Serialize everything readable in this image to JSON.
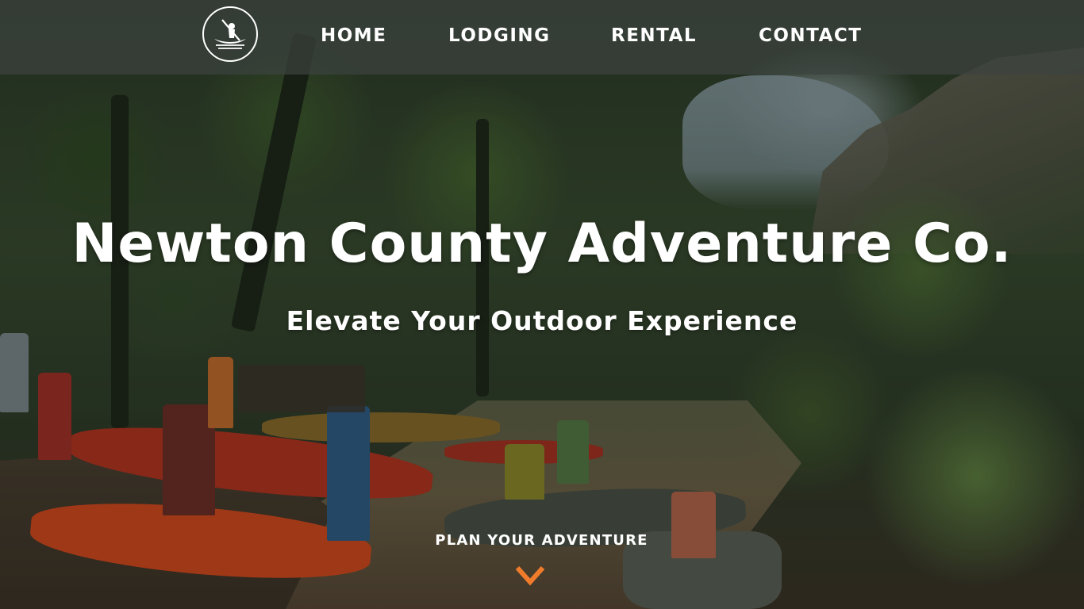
{
  "colors": {
    "accent": "#f07c2b",
    "nav_background": "rgba(60,66,62,0.72)",
    "text": "#ffffff"
  },
  "nav": {
    "logo_icon": "kayaker-logo-icon",
    "links": [
      {
        "label": "HOME"
      },
      {
        "label": "LODGING"
      },
      {
        "label": "RENTAL"
      },
      {
        "label": "CONTACT"
      }
    ]
  },
  "hero": {
    "title": "Newton County Adventure Co.",
    "subtitle": "Elevate Your Outdoor Experience",
    "cta_label": "PLAN YOUR ADVENTURE",
    "cta_icon": "chevron-down-icon"
  }
}
